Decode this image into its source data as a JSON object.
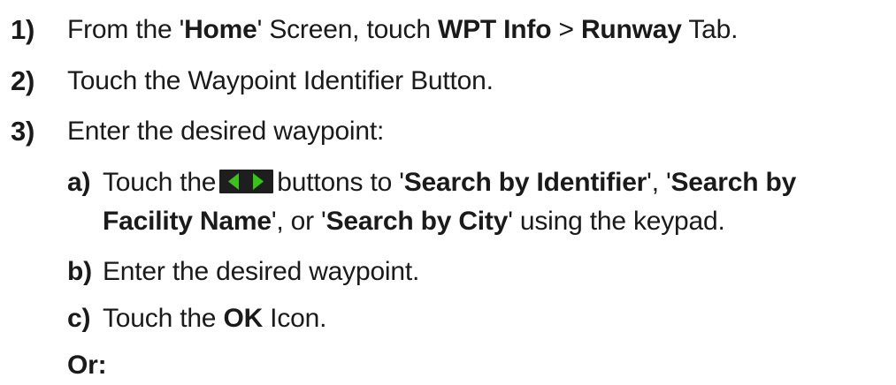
{
  "steps": [
    {
      "number": "1)",
      "parts": [
        "From the '",
        "Home",
        "' Screen, touch ",
        "WPT Info",
        " > ",
        "Runway",
        " Tab."
      ]
    },
    {
      "number": "2)",
      "text": "Touch the Waypoint Identifier Button."
    },
    {
      "number": "3)",
      "text": "Enter the desired waypoint:",
      "substeps": [
        {
          "letter": "a)",
          "line1_parts": [
            "Touch the",
            "buttons to '",
            "Search by Identifier",
            "', '",
            "Search by"
          ],
          "line2_parts": [
            "Facility Name",
            "', or '",
            "Search by City",
            "' using the keypad."
          ]
        },
        {
          "letter": "b)",
          "text": "Enter the desired waypoint."
        },
        {
          "letter": "c)",
          "parts": [
            "Touch the ",
            "OK",
            " Icon."
          ]
        }
      ]
    }
  ],
  "or_label": "Or:",
  "icons": {
    "arrow_buttons": "left-right-arrow-buttons-icon",
    "arrow_color": "#39c21a",
    "arrow_bg": "#1e1e1e"
  }
}
